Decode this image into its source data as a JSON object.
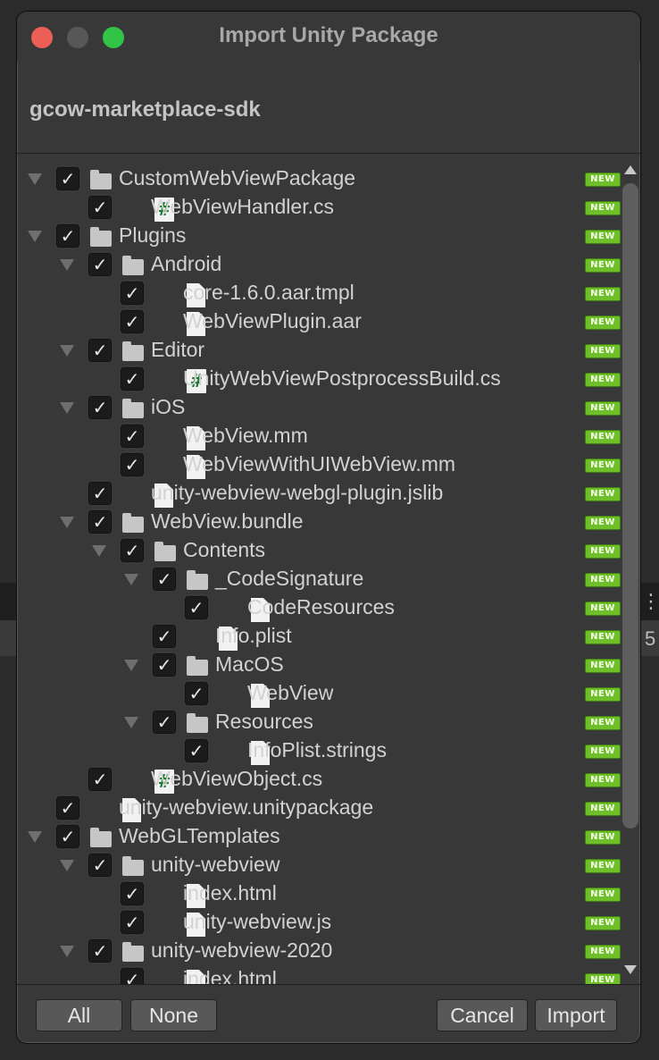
{
  "window": {
    "title": "Import Unity Package",
    "package_name": "gcow-marketplace-sdk"
  },
  "background": {
    "glyph_a": "⋮",
    "glyph_b": "5"
  },
  "badge_text": "NEW",
  "check_glyph": "✓",
  "cs_glyph": "#",
  "tree": [
    {
      "label": "CustomWebViewPackage",
      "depth": 0,
      "type": "folder",
      "expanded": true,
      "checked": true
    },
    {
      "label": "WebViewHandler.cs",
      "depth": 1,
      "type": "cs",
      "checked": true
    },
    {
      "label": "Plugins",
      "depth": 0,
      "type": "folder",
      "expanded": true,
      "checked": true
    },
    {
      "label": "Android",
      "depth": 1,
      "type": "folder",
      "expanded": true,
      "checked": true
    },
    {
      "label": "core-1.6.0.aar.tmpl",
      "depth": 2,
      "type": "file",
      "checked": true
    },
    {
      "label": "WebViewPlugin.aar",
      "depth": 2,
      "type": "file",
      "checked": true
    },
    {
      "label": "Editor",
      "depth": 1,
      "type": "folder",
      "expanded": true,
      "checked": true
    },
    {
      "label": "UnityWebViewPostprocessBuild.cs",
      "depth": 2,
      "type": "cs",
      "checked": true
    },
    {
      "label": "iOS",
      "depth": 1,
      "type": "folder",
      "expanded": true,
      "checked": true
    },
    {
      "label": "WebView.mm",
      "depth": 2,
      "type": "file",
      "checked": true
    },
    {
      "label": "WebViewWithUIWebView.mm",
      "depth": 2,
      "type": "file",
      "checked": true
    },
    {
      "label": "unity-webview-webgl-plugin.jslib",
      "depth": 1,
      "type": "file",
      "checked": true
    },
    {
      "label": "WebView.bundle",
      "depth": 1,
      "type": "folder",
      "expanded": true,
      "checked": true
    },
    {
      "label": "Contents",
      "depth": 2,
      "type": "folder",
      "expanded": true,
      "checked": true
    },
    {
      "label": "_CodeSignature",
      "depth": 3,
      "type": "folder",
      "expanded": true,
      "checked": true
    },
    {
      "label": "CodeResources",
      "depth": 4,
      "type": "file",
      "checked": true
    },
    {
      "label": "Info.plist",
      "depth": 3,
      "type": "file",
      "checked": true
    },
    {
      "label": "MacOS",
      "depth": 3,
      "type": "folder",
      "expanded": true,
      "checked": true
    },
    {
      "label": "WebView",
      "depth": 4,
      "type": "file",
      "checked": true
    },
    {
      "label": "Resources",
      "depth": 3,
      "type": "folder",
      "expanded": true,
      "checked": true
    },
    {
      "label": "InfoPlist.strings",
      "depth": 4,
      "type": "file",
      "checked": true
    },
    {
      "label": "WebViewObject.cs",
      "depth": 1,
      "type": "cs",
      "checked": true
    },
    {
      "label": "unity-webview.unitypackage",
      "depth": 0,
      "type": "file",
      "checked": true
    },
    {
      "label": "WebGLTemplates",
      "depth": 0,
      "type": "folder",
      "expanded": true,
      "checked": true
    },
    {
      "label": "unity-webview",
      "depth": 1,
      "type": "folder",
      "expanded": true,
      "checked": true
    },
    {
      "label": "index.html",
      "depth": 2,
      "type": "file",
      "checked": true
    },
    {
      "label": "unity-webview.js",
      "depth": 2,
      "type": "file",
      "checked": true
    },
    {
      "label": "unity-webview-2020",
      "depth": 1,
      "type": "folder",
      "expanded": true,
      "checked": true
    },
    {
      "label": "index.html",
      "depth": 2,
      "type": "file",
      "checked": true
    }
  ],
  "buttons": {
    "all": "All",
    "none": "None",
    "cancel": "Cancel",
    "import": "Import"
  }
}
